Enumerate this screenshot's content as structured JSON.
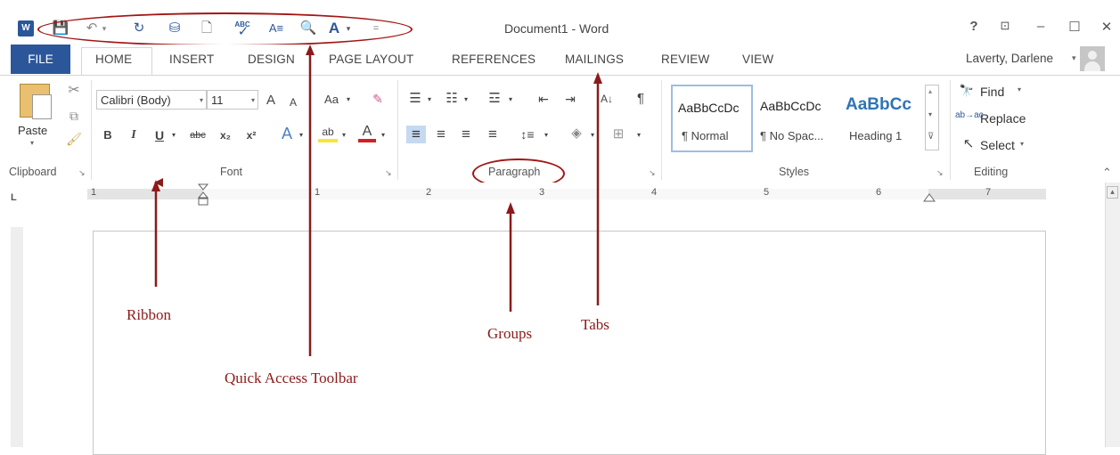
{
  "title_bar": {
    "app_icon": "W",
    "document_title": "Document1 - Word",
    "help": "?",
    "ribbon_display": "⊡",
    "minimize": "–",
    "maximize": "☐",
    "close": "✕"
  },
  "quick_access": {
    "save_icon": "💾",
    "undo_icon": "↶",
    "undo_arrow": "▾",
    "redo_icon": "↻",
    "sync_icon": "⛁",
    "new_icon": "🗋",
    "spelling_label": "ABC",
    "spelling_check": "✓",
    "format_icon": "A≡",
    "preview_icon": "🔍",
    "styles_icon": "A",
    "styles_arrow": "▾",
    "customize_icon": "="
  },
  "tabs": {
    "file": "FILE",
    "home": "HOME",
    "insert": "INSERT",
    "design": "DESIGN",
    "page_layout": "PAGE LAYOUT",
    "references": "REFERENCES",
    "mailings": "MAILINGS",
    "review": "REVIEW",
    "view": "VIEW"
  },
  "user": {
    "name": "Laverty, Darlene",
    "arrow": "▾"
  },
  "clipboard": {
    "paste_label": "Paste",
    "paste_arrow": "▾",
    "cut_icon": "✂",
    "copy_icon": "⧉",
    "painter_icon": "🖌",
    "group_label": "Clipboard",
    "launcher": "↘"
  },
  "font": {
    "family": "Calibri (Body)",
    "size": "11",
    "combo_arrow": "▾",
    "grow": "A",
    "shrink": "A",
    "change_case": "Aa",
    "change_case_arrow": "▾",
    "clear_format": "✎",
    "bold": "B",
    "italic": "I",
    "underline": "U",
    "underline_arrow": "▾",
    "strikethrough": "abc",
    "subscript": "x₂",
    "superscript": "x²",
    "text_effects": "A",
    "effects_arrow": "▾",
    "highlight": "ab",
    "highlight_arrow": "▾",
    "font_color": "A",
    "font_color_arrow": "▾",
    "group_label": "Font",
    "launcher": "↘"
  },
  "paragraph": {
    "bullets": "☰",
    "numbering": "☷",
    "multilevel": "☲",
    "list_arrow": "▾",
    "decrease_indent": "⇤",
    "increase_indent": "⇥",
    "sort": "A↓",
    "show_marks": "¶",
    "align_left": "≡",
    "align_center": "≡",
    "align_right": "≡",
    "justify": "≡",
    "line_spacing": "↕≡",
    "line_spacing_arrow": "▾",
    "shading": "◈",
    "shading_arrow": "▾",
    "borders": "⊞",
    "borders_arrow": "▾",
    "group_label": "Paragraph",
    "launcher": "↘"
  },
  "styles": {
    "items": [
      {
        "sample": "AaBbCcDc",
        "name": "¶ Normal"
      },
      {
        "sample": "AaBbCcDc",
        "name": "¶ No Spac..."
      },
      {
        "sample": "AaBbCc",
        "name": "Heading 1"
      }
    ],
    "scroll_up": "▴",
    "scroll_down": "▾",
    "more": "⊽",
    "group_label": "Styles",
    "launcher": "↘"
  },
  "editing": {
    "find": "Find",
    "find_icon": "🔭",
    "find_arrow": "▾",
    "replace": "Replace",
    "replace_icon": "ab→ac",
    "select": "Select",
    "select_icon": "↖",
    "select_arrow": "▾",
    "group_label": "Editing",
    "collapse": "⌃"
  },
  "ruler": {
    "tab_selector": "L",
    "numbers": [
      "1",
      "1",
      "2",
      "3",
      "4",
      "5",
      "6",
      "7"
    ]
  },
  "annotations": {
    "ribbon": "Ribbon",
    "quick_access_toolbar": "Quick Access Toolbar",
    "groups": "Groups",
    "tabs": "Tabs"
  },
  "colors": {
    "accent": "#2b579a",
    "annotation": "#a31515"
  }
}
